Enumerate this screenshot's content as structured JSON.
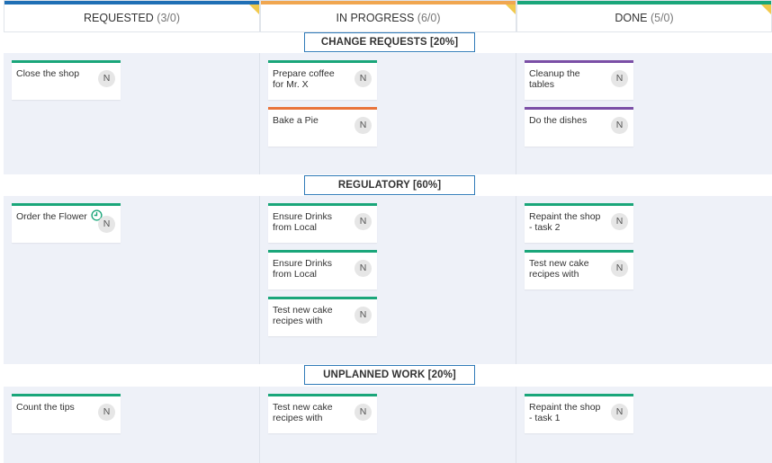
{
  "columns": [
    {
      "name": "REQUESTED",
      "count": "(3/0)",
      "color": "#1f6fb5"
    },
    {
      "name": "IN PROGRESS",
      "count": "(6/0)",
      "color": "#f0a650"
    },
    {
      "name": "DONE",
      "count": "(5/0)",
      "color": "#1aa67a"
    }
  ],
  "lanes": [
    {
      "title": "CHANGE REQUESTS [20%]",
      "columns": [
        [
          {
            "title": "Close the shop",
            "avatar": "N",
            "stripe": "#1aa67a"
          }
        ],
        [
          {
            "title": "Prepare coffee for Mr. X",
            "avatar": "N",
            "stripe": "#1aa67a"
          },
          {
            "title": "Bake a Pie",
            "avatar": "N",
            "stripe": "#e8743b"
          }
        ],
        [
          {
            "title": "Cleanup the tables",
            "avatar": "N",
            "stripe": "#7b4fa6"
          },
          {
            "title": "Do the dishes",
            "avatar": "N",
            "stripe": "#7b4fa6"
          }
        ]
      ]
    },
    {
      "title": "REGULATORY [60%]",
      "columns": [
        [
          {
            "title": "Order the Flower",
            "avatar": "N",
            "stripe": "#1aa67a",
            "icon": "clock-icon"
          }
        ],
        [
          {
            "title": "Ensure Drinks from Local",
            "avatar": "N",
            "stripe": "#1aa67a"
          },
          {
            "title": "Ensure Drinks from Local",
            "avatar": "N",
            "stripe": "#1aa67a"
          },
          {
            "title": "Test new cake recipes with",
            "avatar": "N",
            "stripe": "#1aa67a"
          }
        ],
        [
          {
            "title": "Repaint the shop - task 2",
            "avatar": "N",
            "stripe": "#1aa67a"
          },
          {
            "title": "Test new cake recipes with",
            "avatar": "N",
            "stripe": "#1aa67a"
          }
        ]
      ]
    },
    {
      "title": "UNPLANNED WORK [20%]",
      "columns": [
        [
          {
            "title": "Count the tips",
            "avatar": "N",
            "stripe": "#1aa67a"
          }
        ],
        [
          {
            "title": "Test new cake recipes with",
            "avatar": "N",
            "stripe": "#1aa67a"
          }
        ],
        [
          {
            "title": "Repaint the shop - task 1",
            "avatar": "N",
            "stripe": "#1aa67a"
          }
        ]
      ]
    }
  ]
}
